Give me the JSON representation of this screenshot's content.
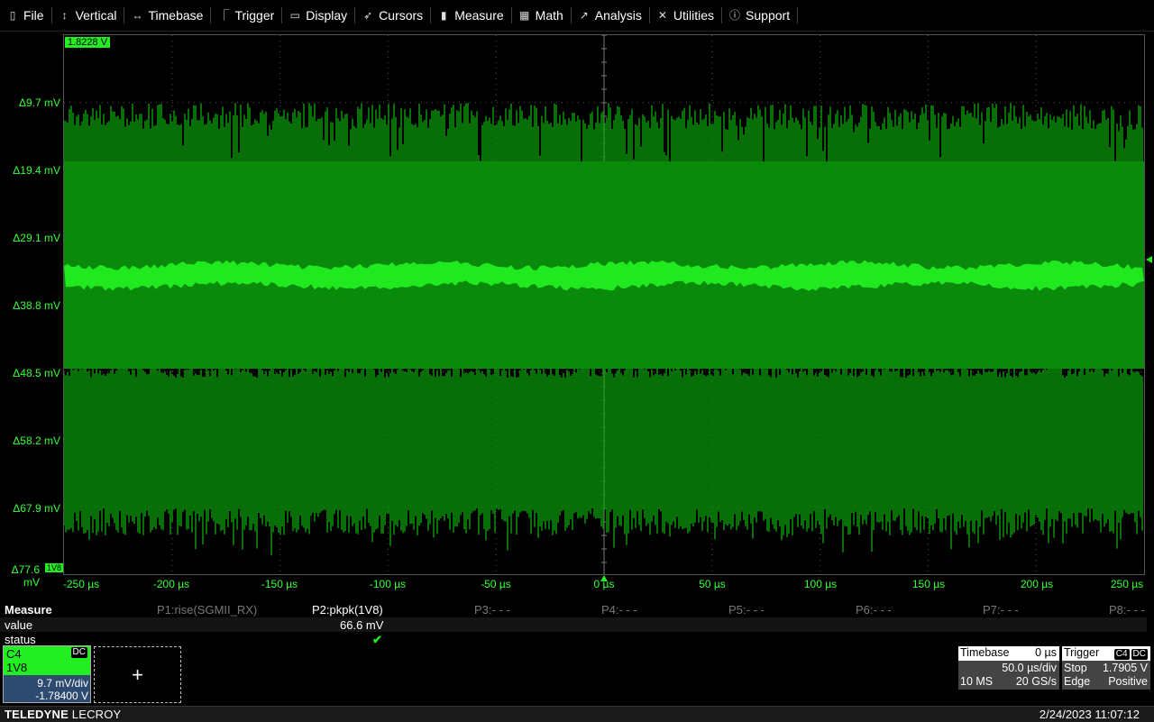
{
  "menu": [
    {
      "label": "File",
      "icon": "file-icon"
    },
    {
      "label": "Vertical",
      "icon": "vertical-arrows-icon"
    },
    {
      "label": "Timebase",
      "icon": "horizontal-arrows-icon"
    },
    {
      "label": "Trigger",
      "icon": "trigger-icon"
    },
    {
      "label": "Display",
      "icon": "display-icon"
    },
    {
      "label": "Cursors",
      "icon": "cursor-icon"
    },
    {
      "label": "Measure",
      "icon": "measure-icon"
    },
    {
      "label": "Math",
      "icon": "calculator-icon"
    },
    {
      "label": "Analysis",
      "icon": "chart-icon"
    },
    {
      "label": "Utilities",
      "icon": "tools-icon"
    },
    {
      "label": "Support",
      "icon": "info-icon"
    }
  ],
  "display": {
    "level_badge": "1.8228 V",
    "channel_marker": "1V8",
    "y_labels": [
      "Δ9.7 mV",
      "Δ19.4 mV",
      "Δ29.1 mV",
      "Δ38.8 mV",
      "Δ48.5 mV",
      "Δ58.2 mV",
      "Δ67.9 mV",
      "Δ77.6 mV"
    ],
    "x_labels": [
      "-250 µs",
      "-200 µs",
      "-150 µs",
      "-100 µs",
      "-50 µs",
      "0 µs",
      "50 µs",
      "100 µs",
      "150 µs",
      "200 µs",
      "250 µs"
    ],
    "trace_color": "#22ee22",
    "trace_dark_color": "#0a8a0a"
  },
  "measure": {
    "title": "Measure",
    "params": [
      "P1:rise(SGMII_RX)",
      "P2:pkpk(1V8)",
      "P3:- - -",
      "P4:- - -",
      "P5:- - -",
      "P6:- - -",
      "P7:- - -",
      "P8:- - -"
    ],
    "row_value_label": "value",
    "row_status_label": "status",
    "p2_value": "66.6 mV",
    "p2_status": "✔"
  },
  "channel": {
    "name": "C4",
    "coupling": "DC",
    "label": "1V8",
    "vdiv": "9.7 mV/div",
    "offset": "-1.78400 V"
  },
  "add_label": "+",
  "timebase": {
    "title": "Timebase",
    "delay": "0 µs",
    "tdiv": "50.0 µs/div",
    "samples": "10 MS",
    "rate": "20 GS/s"
  },
  "trigger": {
    "title": "Trigger",
    "source": "C4",
    "coupling": "DC",
    "mode": "Stop",
    "level": "1.7905 V",
    "type": "Edge",
    "slope": "Positive"
  },
  "status": {
    "brand_bold": "TELEDYNE",
    "brand_light": "LECROY",
    "datetime": "2/24/2023 11:07:12"
  }
}
